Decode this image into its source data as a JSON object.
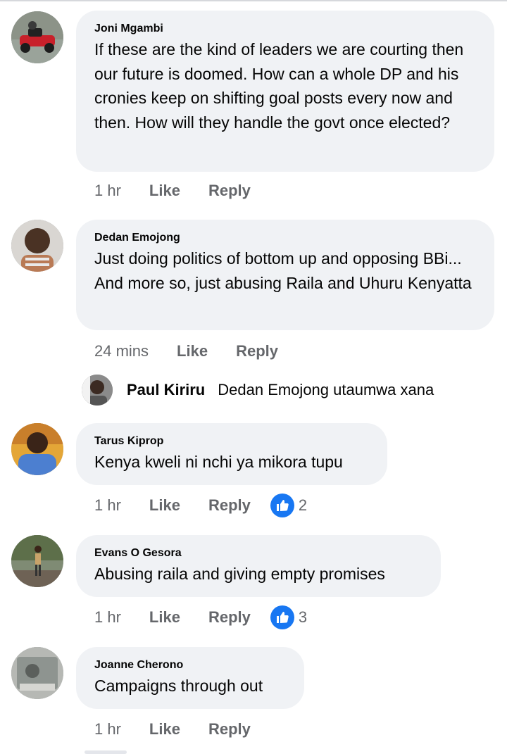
{
  "comments": [
    {
      "author": "Joni Mgambi",
      "text": "If these are the kind of leaders we are courting then our future is doomed. How can a whole DP and his cronies keep on shifting goal posts every now and then. How will they handle the govt once elected?",
      "time": "1 hr",
      "like_label": "Like",
      "reply_label": "Reply"
    },
    {
      "author": "Dedan Emojong",
      "text": "Just doing politics of bottom up and opposing BBi... And more so, just abusing Raila and Uhuru Kenyatta",
      "time": "24 mins",
      "like_label": "Like",
      "reply_label": "Reply",
      "reply": {
        "author": "Paul Kiriru",
        "text": "Dedan Emojong utaumwa xana"
      }
    },
    {
      "author": "Tarus Kiprop",
      "text": "Kenya kweli ni nchi ya mikora tupu",
      "time": "1 hr",
      "like_label": "Like",
      "reply_label": "Reply",
      "reactions": "2",
      "reaction_icon": "thumbs-up-icon"
    },
    {
      "author": "Evans O Gesora",
      "text": "Abusing raila and giving empty promises",
      "time": "1 hr",
      "like_label": "Like",
      "reply_label": "Reply",
      "reactions": "3",
      "reaction_icon": "thumbs-up-icon"
    },
    {
      "author": "Joanne Cherono",
      "text": "Campaigns through out",
      "time": "1 hr",
      "like_label": "Like",
      "reply_label": "Reply"
    }
  ],
  "colors": {
    "bubble": "#f0f2f5",
    "meta": "#65676b",
    "like_badge": "#1877f2"
  }
}
